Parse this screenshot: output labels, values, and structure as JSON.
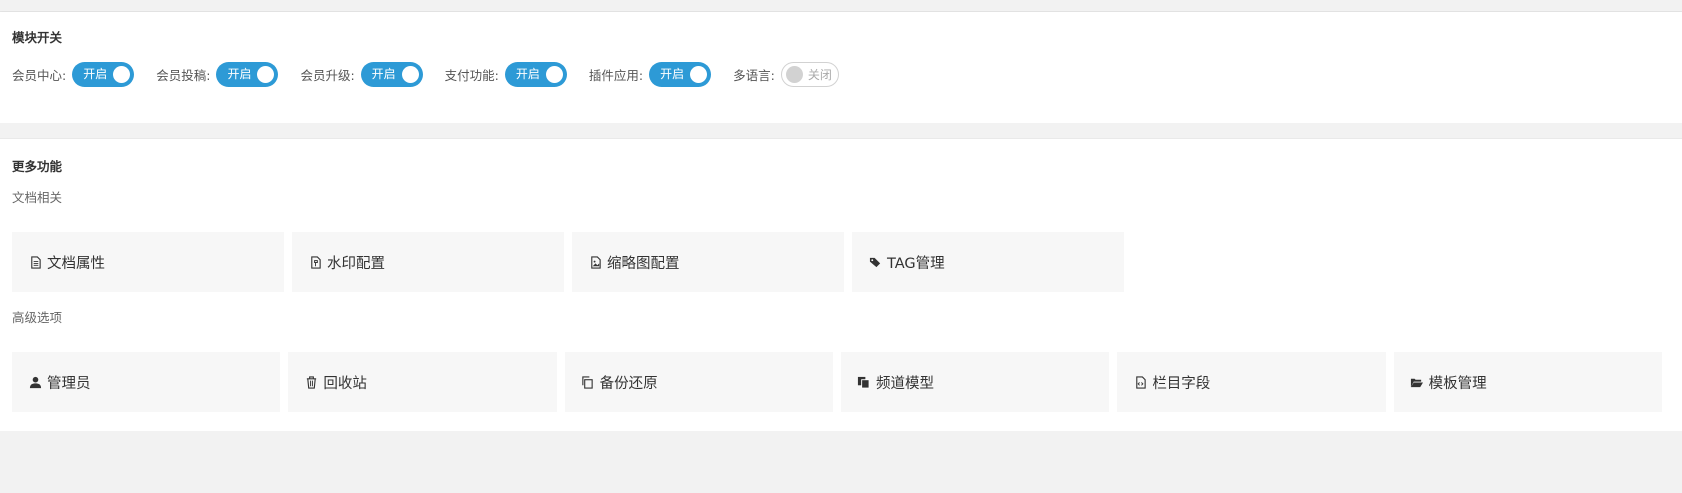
{
  "modules": {
    "title": "模块开关",
    "switches": [
      {
        "label": "会员中心:",
        "state": "开启",
        "on": true
      },
      {
        "label": "会员投稿:",
        "state": "开启",
        "on": true
      },
      {
        "label": "会员升级:",
        "state": "开启",
        "on": true
      },
      {
        "label": "支付功能:",
        "state": "开启",
        "on": true
      },
      {
        "label": "插件应用:",
        "state": "开启",
        "on": true
      },
      {
        "label": "多语言:",
        "state": "关闭",
        "on": false
      }
    ]
  },
  "more": {
    "title": "更多功能",
    "doc_group": {
      "label": "文档相关",
      "items": [
        {
          "label": "文档属性",
          "icon": "file-text-icon"
        },
        {
          "label": "水印配置",
          "icon": "file-watermark-icon"
        },
        {
          "label": "缩略图配置",
          "icon": "image-icon"
        },
        {
          "label": "TAG管理",
          "icon": "tags-icon"
        }
      ]
    },
    "adv_group": {
      "label": "高级选项",
      "items": [
        {
          "label": "管理员",
          "icon": "user-icon"
        },
        {
          "label": "回收站",
          "icon": "trash-icon"
        },
        {
          "label": "备份还原",
          "icon": "copy-icon"
        },
        {
          "label": "频道模型",
          "icon": "files-icon"
        },
        {
          "label": "栏目字段",
          "icon": "file-code-icon"
        },
        {
          "label": "模板管理",
          "icon": "folder-open-icon"
        }
      ]
    }
  },
  "colors": {
    "accent": "#2d9ad6",
    "card_bg": "#f7f7f7",
    "page_bg": "#f2f2f2"
  }
}
